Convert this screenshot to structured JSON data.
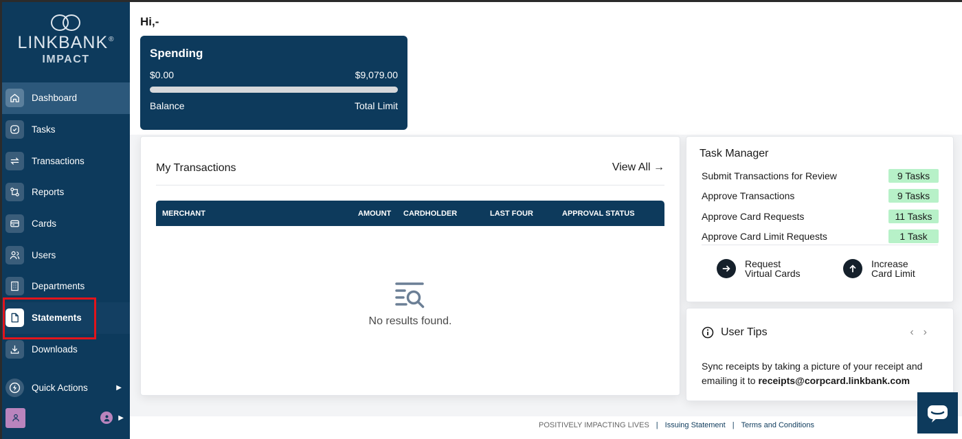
{
  "brand": {
    "name": "LINKBANK",
    "registered": "®",
    "sub": "IMPACT"
  },
  "sidebar": {
    "items": [
      {
        "label": "Dashboard",
        "icon": "home-icon"
      },
      {
        "label": "Tasks",
        "icon": "check-circle-icon"
      },
      {
        "label": "Transactions",
        "icon": "swap-arrows-icon"
      },
      {
        "label": "Reports",
        "icon": "reports-icon"
      },
      {
        "label": "Cards",
        "icon": "card-icon"
      },
      {
        "label": "Users",
        "icon": "users-icon"
      },
      {
        "label": "Departments",
        "icon": "building-icon"
      },
      {
        "label": "Statements",
        "icon": "document-icon"
      },
      {
        "label": "Downloads",
        "icon": "download-icon"
      }
    ],
    "quick_actions": "Quick Actions",
    "active_item": "Dashboard",
    "selected_item": "Statements"
  },
  "greeting": "Hi,-",
  "spending": {
    "title": "Spending",
    "balance_value": "$0.00",
    "limit_value": "$9,079.00",
    "balance_label": "Balance",
    "limit_label": "Total Limit",
    "progress": 0
  },
  "transactions": {
    "title": "My Transactions",
    "view_all": "View All",
    "columns": [
      "MERCHANT",
      "AMOUNT",
      "CARDHOLDER",
      "LAST FOUR",
      "APPROVAL STATUS"
    ],
    "empty_text": "No results found."
  },
  "task_manager": {
    "title": "Task Manager",
    "rows": [
      {
        "label": "Submit Transactions for Review",
        "badge": "9 Tasks"
      },
      {
        "label": "Approve Transactions",
        "badge": "9 Tasks"
      },
      {
        "label": "Approve Card Requests",
        "badge": "11 Tasks"
      },
      {
        "label": "Approve Card Limit Requests",
        "badge": "1 Task"
      }
    ],
    "actions": [
      {
        "line1": "Request",
        "line2": "Virtual Cards"
      },
      {
        "line1": "Increase",
        "line2": "Card Limit"
      }
    ]
  },
  "tips": {
    "title": "User Tips",
    "text_prefix": "Sync receipts by taking a picture of your receipt and emailing it to ",
    "email": "receipts@corpcard.linkbank.com"
  },
  "footer": {
    "tagline": "POSITIVELY IMPACTING LIVES",
    "link1": "Issuing Statement",
    "link2": "Terms and Conditions"
  },
  "colors": {
    "navy": "#0d3a5c",
    "badge_green": "#b7f1c8",
    "highlight_red": "#e3141b"
  }
}
